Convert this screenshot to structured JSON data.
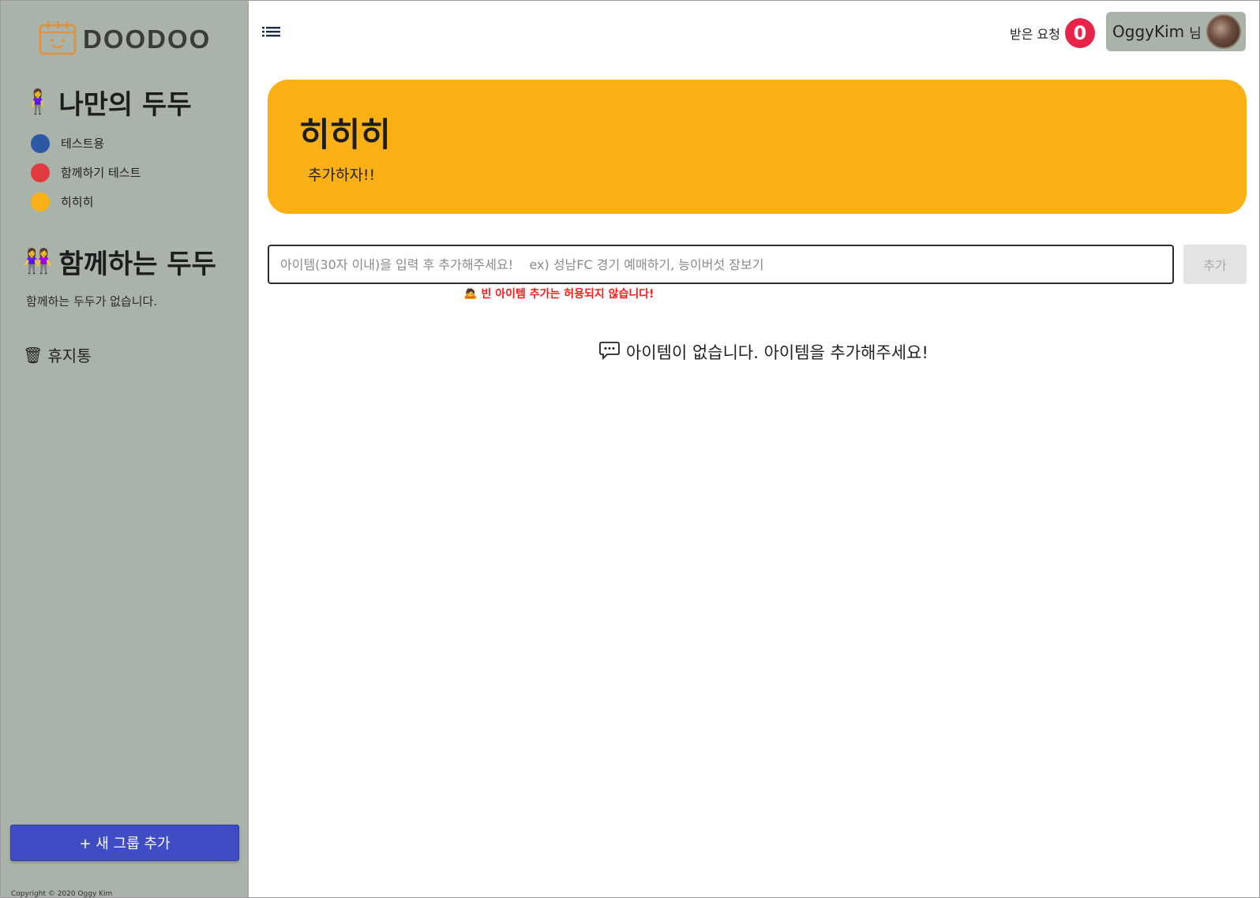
{
  "sidebar": {
    "logo_text": "DOODOO",
    "my_section": {
      "emoji": "🧍‍♀️",
      "title": "나만의 두두"
    },
    "groups": [
      {
        "label": "테스트용",
        "color": "#2d58a6"
      },
      {
        "label": "함께하기 테스트",
        "color": "#e03a3e"
      },
      {
        "label": "히히히",
        "color": "#fbb016"
      }
    ],
    "shared_section": {
      "emoji": "👭",
      "title": "함께하는 두두",
      "empty_text": "함께하는 두두가 없습니다."
    },
    "trash": {
      "emoji": "🗑",
      "label": "휴지통"
    },
    "new_group_button": "+ 새 그룹 추가",
    "copyright": "Copyright © 2020 Oggy Kim"
  },
  "header": {
    "requests_label": "받은 요청",
    "requests_count": "0",
    "user_name": "OggyKim",
    "user_suffix": "님"
  },
  "group": {
    "title": "히히히",
    "description": "추가하자!!",
    "color": "#fbb016"
  },
  "item_form": {
    "placeholder": "아이템(30자 이내)을 입력 후 추가해주세요!    ex) 성남FC 경기 예매하기, 능이버섯 장보기",
    "value": "",
    "add_button": "추가",
    "warning_emoji": "🙇",
    "warning_text": "빈 아이템 추가는 허용되지 않습니다!"
  },
  "empty_state": {
    "text": "아이템이 없습니다. 아이템을 추가해주세요!"
  }
}
